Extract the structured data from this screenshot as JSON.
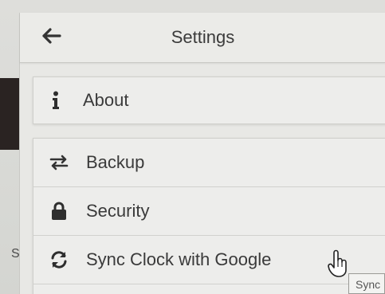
{
  "header": {
    "title": "Settings",
    "back_icon": "arrow-left-icon"
  },
  "about": {
    "label": "About",
    "icon": "info-icon"
  },
  "menu": {
    "items": [
      {
        "label": "Backup",
        "icon": "swap-arrows-icon"
      },
      {
        "label": "Security",
        "icon": "lock-icon"
      },
      {
        "label": "Sync Clock with Google",
        "icon": "sync-icon"
      }
    ]
  },
  "background": {
    "left_letter": "S"
  },
  "tooltip": {
    "text": "Sync"
  },
  "colors": {
    "text": "#3a3a3a",
    "panel": "#e8e8e5",
    "card": "#ededeb"
  }
}
